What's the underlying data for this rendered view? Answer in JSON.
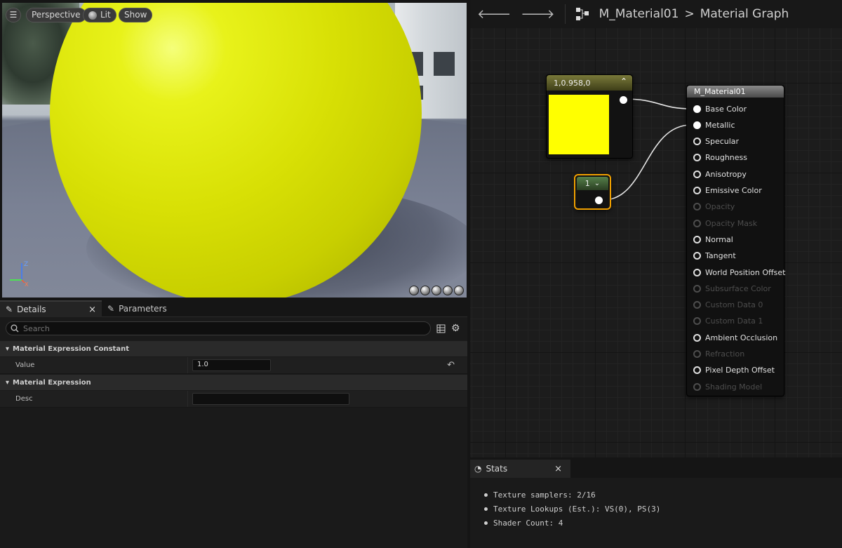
{
  "viewport": {
    "perspective_label": "Perspective",
    "lit_label": "Lit",
    "show_label": "Show",
    "axis_z": "Z",
    "axis_x": "X"
  },
  "details_panel": {
    "tabs": [
      {
        "label": "Details"
      },
      {
        "label": "Parameters"
      }
    ],
    "search_placeholder": "Search",
    "categories": [
      {
        "title": "Material Expression Constant",
        "properties": [
          {
            "label": "Value",
            "value": "1.0"
          }
        ]
      },
      {
        "title": "Material Expression",
        "properties": [
          {
            "label": "Desc",
            "value": ""
          }
        ]
      }
    ]
  },
  "graph": {
    "breadcrumb": {
      "asset": "M_Material01",
      "separator": ">",
      "graph": "Material Graph"
    },
    "color_node": {
      "title": "1,0.958,0",
      "color": "#ffff00"
    },
    "constant_node": {
      "value": "1"
    },
    "material_node": {
      "title": "M_Material01",
      "inputs": [
        {
          "label": "Base Color",
          "state": "connected"
        },
        {
          "label": "Metallic",
          "state": "connected"
        },
        {
          "label": "Specular",
          "state": "enabled"
        },
        {
          "label": "Roughness",
          "state": "enabled"
        },
        {
          "label": "Anisotropy",
          "state": "enabled"
        },
        {
          "label": "Emissive Color",
          "state": "enabled"
        },
        {
          "label": "Opacity",
          "state": "disabled"
        },
        {
          "label": "Opacity Mask",
          "state": "disabled"
        },
        {
          "label": "Normal",
          "state": "enabled"
        },
        {
          "label": "Tangent",
          "state": "enabled"
        },
        {
          "label": "World Position Offset",
          "state": "enabled"
        },
        {
          "label": "Subsurface Color",
          "state": "disabled"
        },
        {
          "label": "Custom Data 0",
          "state": "disabled"
        },
        {
          "label": "Custom Data 1",
          "state": "disabled"
        },
        {
          "label": "Ambient Occlusion",
          "state": "enabled"
        },
        {
          "label": "Refraction",
          "state": "disabled"
        },
        {
          "label": "Pixel Depth Offset",
          "state": "enabled"
        },
        {
          "label": "Shading Model",
          "state": "disabled"
        }
      ]
    }
  },
  "stats": {
    "tab_label": "Stats",
    "lines": [
      "Texture samplers: 2/16",
      "Texture Lookups (Est.): VS(0), PS(3)",
      "Shader Count: 4"
    ]
  },
  "colors": {
    "accent_selection": "#f0a000",
    "sphere": "#d8e005"
  }
}
